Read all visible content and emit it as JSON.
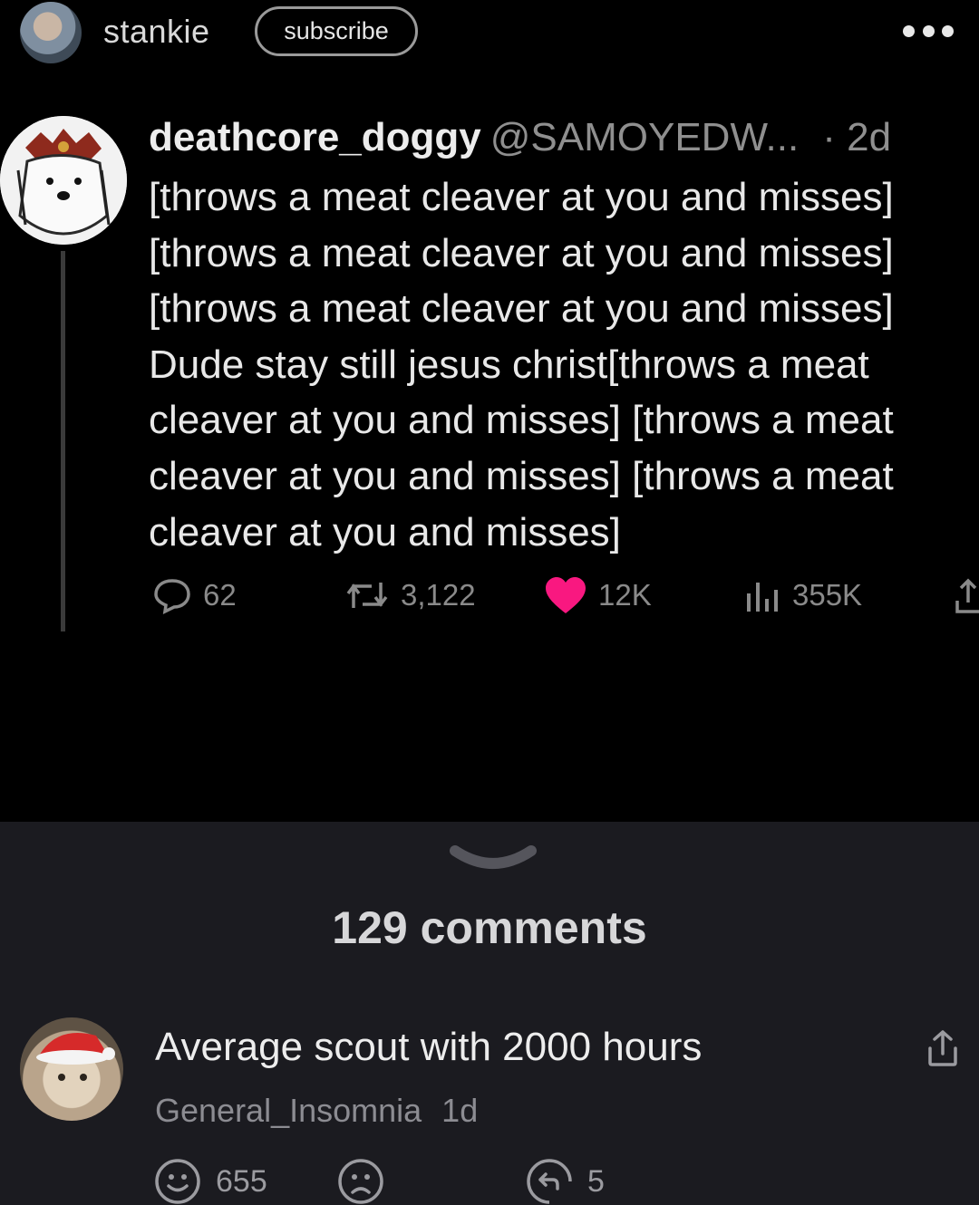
{
  "post": {
    "author": "stankie",
    "subscribe_label": "subscribe",
    "more_label": "more options"
  },
  "tweet": {
    "display_name": "deathcore_doggy",
    "handle": "@SAMOYEDW...",
    "time": "· 2d",
    "lines": [
      "[throws a meat cleaver at you and misses]",
      "[throws a meat cleaver at you and misses]",
      "[throws a meat cleaver at you and misses]",
      "Dude stay still jesus christ[throws a meat",
      "cleaver at you and misses] [throws a meat",
      "cleaver at you and misses] [throws a meat",
      "cleaver at you and misses]"
    ],
    "replies": "62",
    "retweets": "3,122",
    "likes": "12K",
    "views": "355K",
    "like_color": "#f91880"
  },
  "comments": {
    "count_label": "129 comments",
    "items": [
      {
        "text": "Average scout with 2000 hours",
        "author": "General_Insomnia",
        "time": "1d",
        "upvotes": "655",
        "replies": "5"
      }
    ]
  }
}
